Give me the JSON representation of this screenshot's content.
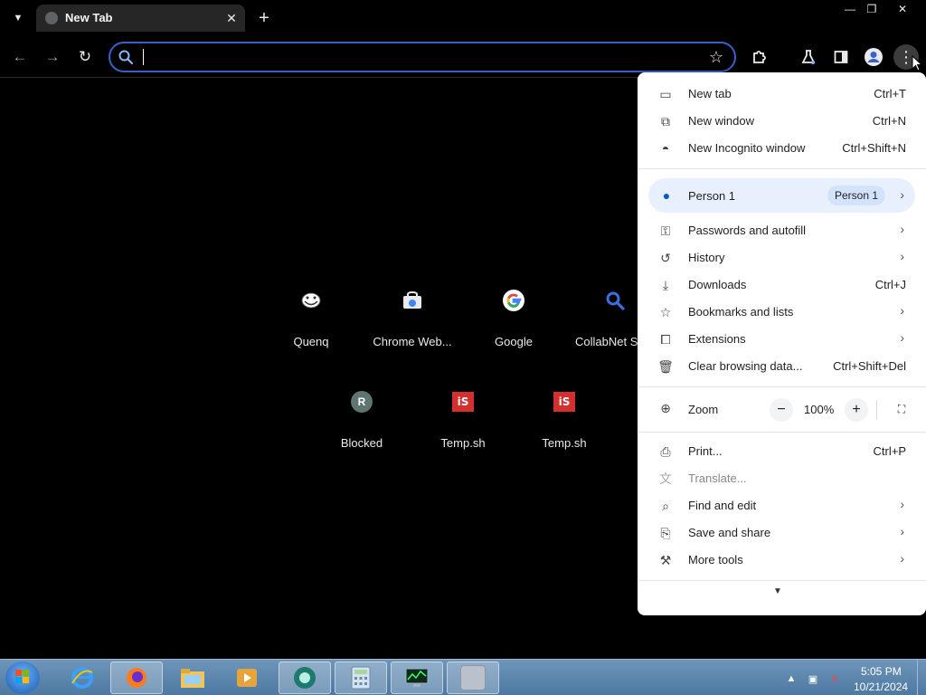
{
  "window": {
    "tab_search_icon": "chevron-down-icon",
    "tab_title": "New Tab",
    "tab_close": "✕",
    "new_tab_symbol": "+",
    "minimize": "—",
    "restore": "❐",
    "close": "✕"
  },
  "toolbar": {
    "back": "←",
    "forward": "→",
    "reload": "↻",
    "address_value": "",
    "bookmark_star": "☆",
    "extensions": "puzzle-icon",
    "labs": "flask-icon",
    "side_panel": "side-panel-icon",
    "profile": "profile-icon",
    "menu": "⋮"
  },
  "shortcuts": [
    {
      "label": "Quenq",
      "icon": "trollface-icon"
    },
    {
      "label": "Chrome Web...",
      "icon": "chrome-web-store-icon"
    },
    {
      "label": "Google",
      "icon": "google-icon"
    },
    {
      "label": "CollabNet Se",
      "icon": "search-icon"
    },
    {
      "label": "Blocked",
      "icon": "letter-avatar-icon",
      "letter": "R"
    },
    {
      "label": "Temp.sh",
      "icon": "temp-sh-icon",
      "badge": "iS"
    },
    {
      "label": "Temp.sh",
      "icon": "temp-sh-icon",
      "badge": "iS"
    }
  ],
  "menu": {
    "new_tab": {
      "label": "New tab",
      "shortcut": "Ctrl+T"
    },
    "new_window": {
      "label": "New window",
      "shortcut": "Ctrl+N"
    },
    "new_incognito": {
      "label": "New Incognito window",
      "shortcut": "Ctrl+Shift+N"
    },
    "person": {
      "label": "Person 1",
      "chip": "Person 1"
    },
    "passwords": {
      "label": "Passwords and autofill"
    },
    "history": {
      "label": "History"
    },
    "downloads": {
      "label": "Downloads",
      "shortcut": "Ctrl+J"
    },
    "bookmarks": {
      "label": "Bookmarks and lists"
    },
    "extensions": {
      "label": "Extensions"
    },
    "clear_data": {
      "label": "Clear browsing data...",
      "shortcut": "Ctrl+Shift+Del"
    },
    "zoom": {
      "label": "Zoom",
      "value": "100%",
      "minus": "−",
      "plus": "+"
    },
    "print": {
      "label": "Print...",
      "shortcut": "Ctrl+P"
    },
    "translate": {
      "label": "Translate..."
    },
    "find_edit": {
      "label": "Find and edit"
    },
    "save_share": {
      "label": "Save and share"
    },
    "more_tools": {
      "label": "More tools"
    },
    "arrow": "›",
    "more_caret": "▼"
  },
  "taskbar": {
    "time": "5:05 PM",
    "date": "10/21/2024",
    "items": [
      "internet-explorer-icon",
      "firefox-icon",
      "file-explorer-icon",
      "media-player-icon",
      "chrome-style-app-icon",
      "calculator-icon",
      "task-manager-icon",
      "blank-window-icon"
    ]
  },
  "colors": {
    "accent": "#3b5fcb",
    "menu_bg": "#ffffff",
    "person_bg": "#e8f0fe",
    "taskbar": "#5a84ad",
    "temp_sh_red": "#d32f2f"
  }
}
